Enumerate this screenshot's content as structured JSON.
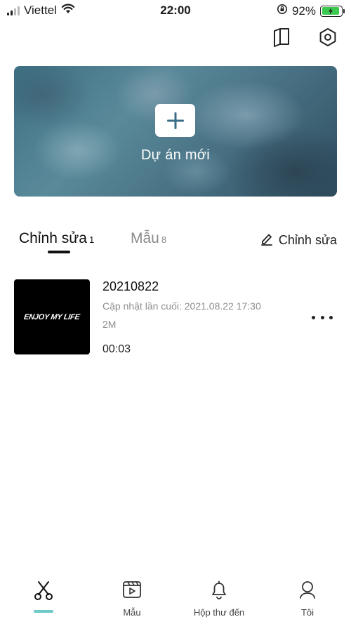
{
  "status_bar": {
    "carrier": "Viettel",
    "time": "22:00",
    "battery_percent": "92%",
    "battery_level": 0.92,
    "battery_color": "#3cc94f"
  },
  "top_icons": [
    "book-icon",
    "gear-icon"
  ],
  "hero": {
    "label": "Dự án mới",
    "icon": "plus-icon"
  },
  "tabs": [
    {
      "label": "Chỉnh sửa",
      "count": "1",
      "active": true
    },
    {
      "label": "Mẫu",
      "count": "8",
      "active": false
    }
  ],
  "edit_action": {
    "label": "Chỉnh sửa",
    "icon": "pencil-icon"
  },
  "projects": [
    {
      "thumbnail_text": "ENJOY MY LIFE",
      "title": "20210822",
      "updated": "Cập nhật lần cuối: 2021.08.22 17:30",
      "size": "2M",
      "duration": "00:03"
    }
  ],
  "bottom_nav": [
    {
      "label": "",
      "icon": "scissors-icon",
      "active": true
    },
    {
      "label": "Mẫu",
      "icon": "video-template-icon",
      "active": false
    },
    {
      "label": "Hộp thư đến",
      "icon": "bell-icon",
      "active": false
    },
    {
      "label": "Tôi",
      "icon": "user-icon",
      "active": false
    }
  ],
  "colors": {
    "accent": "#6dc9c6",
    "hero_plus_icon": "#3b6e86"
  }
}
